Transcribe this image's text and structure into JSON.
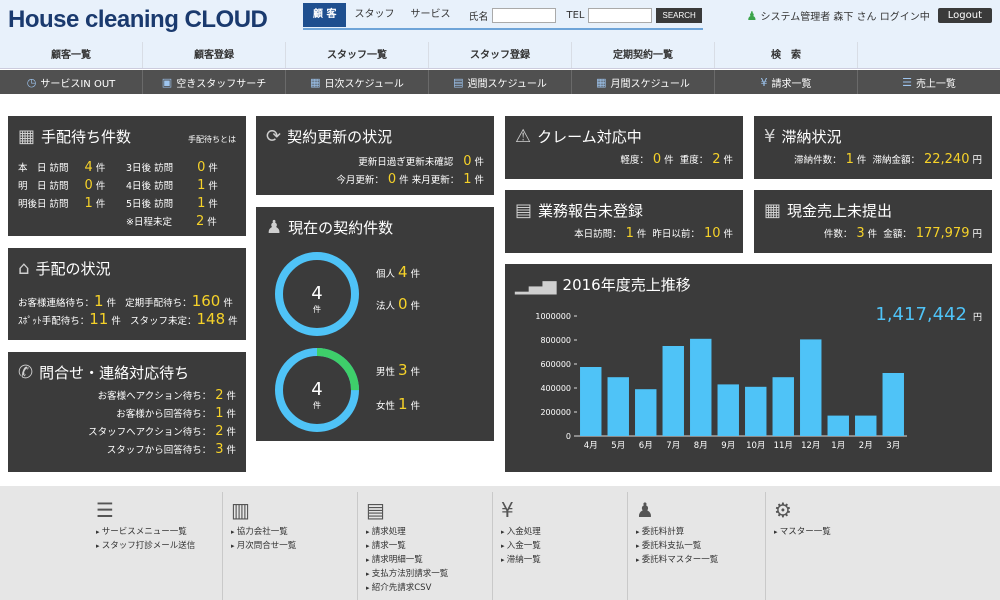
{
  "app": {
    "logo": "House cleaning CLOUD"
  },
  "search": {
    "tabs": [
      "顧 客",
      "スタッフ",
      "サービス"
    ],
    "name_label": "氏名",
    "tel_label": "TEL",
    "button": "SEARCH"
  },
  "user": {
    "text": "システム管理者  森下 さん ログイン中",
    "logout": "Logout"
  },
  "mainnav": [
    "顧客一覧",
    "顧客登録",
    "スタッフ一覧",
    "スタッフ登録",
    "定期契約一覧",
    "検　索",
    ""
  ],
  "subnav": [
    {
      "icon": "clock-icon",
      "glyph": "◷",
      "label": "サービスIN OUT"
    },
    {
      "icon": "staff-search-icon",
      "glyph": "▣",
      "label": "空きスタッフサーチ"
    },
    {
      "icon": "calendar-day-icon",
      "glyph": "▦",
      "label": "日次スケジュール"
    },
    {
      "icon": "calendar-week-icon",
      "glyph": "▤",
      "label": "週間スケジュール"
    },
    {
      "icon": "calendar-month-icon",
      "glyph": "▦",
      "label": "月間スケジュール"
    },
    {
      "icon": "yen-icon",
      "glyph": "¥",
      "label": "請求一覧"
    },
    {
      "icon": "list-icon",
      "glyph": "☰",
      "label": "売上一覧"
    }
  ],
  "arrangement_waiting": {
    "title": "手配待ち件数",
    "note": "手配待ちとは",
    "today": {
      "label": "本　日 訪問",
      "value": "4",
      "unit": "件"
    },
    "tomorrow": {
      "label": "明　日 訪問",
      "value": "0",
      "unit": "件"
    },
    "day_after": {
      "label": "明後日 訪問",
      "value": "1",
      "unit": "件"
    },
    "d3": {
      "label": "3日後 訪問",
      "value": "0",
      "unit": "件"
    },
    "d4": {
      "label": "4日後 訪問",
      "value": "1",
      "unit": "件"
    },
    "d5": {
      "label": "5日後 訪問",
      "value": "1",
      "unit": "件"
    },
    "undecided": {
      "label": "※日程未定",
      "value": "2",
      "unit": "件"
    }
  },
  "arrangement_status": {
    "title": "手配の状況",
    "r1a": {
      "label": "お客様連絡待ち：",
      "value": "1",
      "unit": "件"
    },
    "r1b": {
      "label": "定期手配待ち：",
      "value": "160",
      "unit": "件"
    },
    "r2a": {
      "label": "ｽﾎﾟｯﾄ手配待ち：",
      "value": "11",
      "unit": "件"
    },
    "r2b": {
      "label": "スタッフ未定：",
      "value": "148",
      "unit": "件"
    }
  },
  "inquiry": {
    "title": "問合せ・連絡対応待ち",
    "rows": [
      {
        "label": "お客様へアクション待ち：",
        "value": "2",
        "unit": "件"
      },
      {
        "label": "お客様から回答待ち：",
        "value": "1",
        "unit": "件"
      },
      {
        "label": "スタッフへアクション待ち：",
        "value": "2",
        "unit": "件"
      },
      {
        "label": "スタッフから回答待ち：",
        "value": "3",
        "unit": "件"
      }
    ]
  },
  "contract_renewal": {
    "title": "契約更新の状況",
    "r1": {
      "label": "更新日過ぎ更新未確認",
      "value": "0",
      "unit": "件"
    },
    "r2a": {
      "label": "今月更新：",
      "value": "0",
      "unit": "件"
    },
    "r2b": {
      "label": "来月更新：",
      "value": "1",
      "unit": "件"
    }
  },
  "current_contracts": {
    "title": "現在の契約件数",
    "ring1": {
      "value": "4",
      "unit": "件",
      "fraction": 0.0
    },
    "individual": {
      "label": "個人",
      "value": "4",
      "unit": "件"
    },
    "corporate": {
      "label": "法人",
      "value": "0",
      "unit": "件"
    },
    "ring2": {
      "value": "4",
      "unit": "件",
      "fraction": 0.25
    },
    "male": {
      "label": "男性",
      "value": "3",
      "unit": "件"
    },
    "female": {
      "label": "女性",
      "value": "1",
      "unit": "件"
    },
    "colors": {
      "ring": "#4fc3f7",
      "accent": "#3ecf6a"
    }
  },
  "claims": {
    "title": "クレーム対応中",
    "light": {
      "label": "軽度：",
      "value": "0",
      "unit": "件"
    },
    "heavy": {
      "label": "重度：",
      "value": "2",
      "unit": "件"
    }
  },
  "overdue": {
    "title": "滞納状況",
    "count": {
      "label": "滞納件数：",
      "value": "1",
      "unit": "件"
    },
    "amount": {
      "label": "滞納金額：",
      "value": "22,240",
      "unit": "円"
    }
  },
  "report": {
    "title": "業務報告未登録",
    "today": {
      "label": "本日訪問：",
      "value": "1",
      "unit": "件"
    },
    "before": {
      "label": "昨日以前：",
      "value": "10",
      "unit": "件"
    }
  },
  "cash": {
    "title": "現金売上未提出",
    "count": {
      "label": "件数：",
      "value": "3",
      "unit": "件"
    },
    "amount": {
      "label": "金額：",
      "value": "177,979",
      "unit": "円"
    }
  },
  "sales_chart_panel": {
    "title": "2016年度売上推移",
    "total": "1,417,442",
    "unit": "円"
  },
  "chart_data": {
    "type": "bar",
    "title": "2016年度売上推移",
    "categories": [
      "4月",
      "5月",
      "6月",
      "7月",
      "8月",
      "9月",
      "10月",
      "11月",
      "12月",
      "1月",
      "2月",
      "3月"
    ],
    "values": [
      575000,
      490000,
      390000,
      750000,
      810000,
      430000,
      410000,
      490000,
      805000,
      170000,
      170000,
      525000
    ],
    "ylim": [
      0,
      1000000
    ],
    "yticks": [
      0,
      200000,
      400000,
      600000,
      800000,
      1000000
    ],
    "grid": false,
    "color": "#4fc3f7"
  },
  "footer": [
    {
      "icon": "menu-list-icon",
      "glyph": "☰",
      "links": [
        "サービスメニュー一覧",
        "スタッフ打診メール送信"
      ]
    },
    {
      "icon": "building-icon",
      "glyph": "▥",
      "links": [
        "協力会社一覧",
        "月次問合せ一覧"
      ]
    },
    {
      "icon": "invoice-icon",
      "glyph": "▤",
      "links": [
        "請求処理",
        "請求一覧",
        "請求明細一覧",
        "支払方法別請求一覧",
        "紹介先請求CSV"
      ]
    },
    {
      "icon": "yen-icon",
      "glyph": "¥",
      "links": [
        "入金処理",
        "入金一覧",
        "滞納一覧"
      ]
    },
    {
      "icon": "staff-yen-icon",
      "glyph": "♟",
      "links": [
        "委託料計算",
        "委託料支払一覧",
        "委託料マスター一覧"
      ]
    },
    {
      "icon": "gear-icon",
      "glyph": "⚙",
      "links": [
        "マスター一覧"
      ]
    }
  ]
}
